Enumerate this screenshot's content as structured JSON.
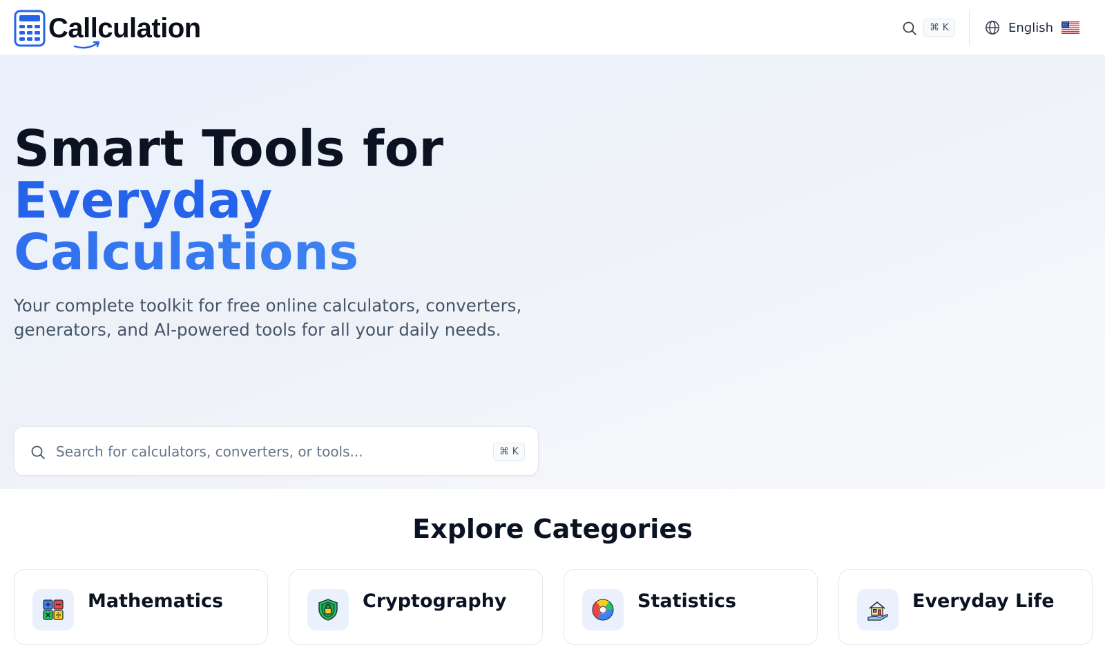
{
  "header": {
    "logo_text": "Callculation",
    "search_shortcut": "⌘ K",
    "language_label": "English",
    "icons": {
      "logo": "calculator-icon",
      "search": "search-icon",
      "language": "globe-icon",
      "flag": "us-flag-icon"
    }
  },
  "hero": {
    "title_line1": "Smart Tools for",
    "title_line2": "Everyday",
    "title_line3": "Calculations",
    "subtitle": "Your complete toolkit for free online calculators, converters, generators, and AI-powered tools for all your daily needs.",
    "search": {
      "placeholder": "Search for calculators, converters, or tools...",
      "value": "",
      "shortcut": "⌘ K"
    },
    "colors": {
      "accent": "#2563eb",
      "accent_light": "#3b82f6"
    }
  },
  "categories": {
    "heading": "Explore Categories",
    "items": [
      {
        "label": "Mathematics",
        "icon": "math-operators-icon"
      },
      {
        "label": "Cryptography",
        "icon": "shield-lock-icon"
      },
      {
        "label": "Statistics",
        "icon": "donut-chart-icon"
      },
      {
        "label": "Everyday Life",
        "icon": "house-hand-icon"
      }
    ]
  }
}
